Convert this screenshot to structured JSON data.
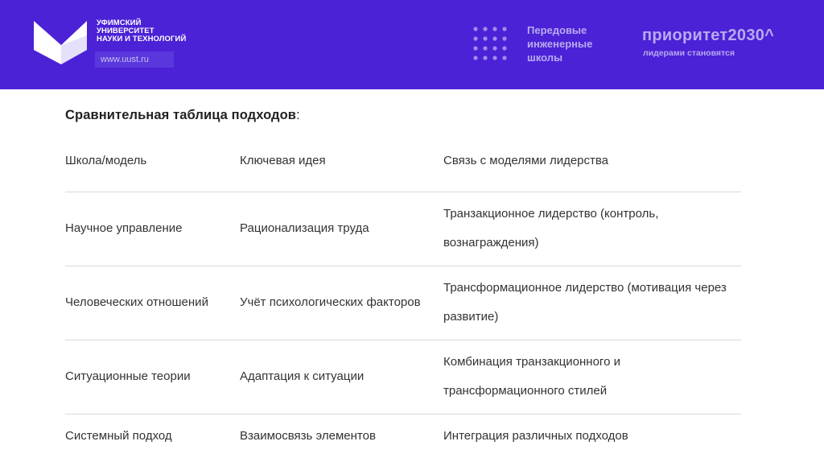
{
  "header": {
    "university_lines": [
      "Уфимский",
      "университет",
      "науки и технологий"
    ],
    "site": "www.uust.ru",
    "program_lines": [
      "Передовые",
      "инженерные",
      "школы"
    ],
    "priority_logo": "приоритет2030^",
    "priority_tagline": "лидерами становятся",
    "brand_color": "#4b22d6"
  },
  "content": {
    "title": "Сравнительная таблица подходов",
    "title_colon": ":",
    "columns": [
      "Школа/модель",
      "Ключевая идея",
      "Связь с моделями лидерства"
    ],
    "rows": [
      [
        "Научное управление",
        "Рационализация труда",
        "Транзакционное лидерство (контроль, вознаграждения)"
      ],
      [
        "Человеческих отношений",
        "Учёт психологических факторов",
        "Трансформационное лидерство (мотивация через развитие)"
      ],
      [
        "Ситуационные теории",
        "Адаптация к ситуации",
        "Комбинация транзакционного и трансформационного стилей"
      ],
      [
        "Системный подход",
        "Взаимосвязь элементов",
        "Интеграция различных подходов"
      ]
    ]
  }
}
